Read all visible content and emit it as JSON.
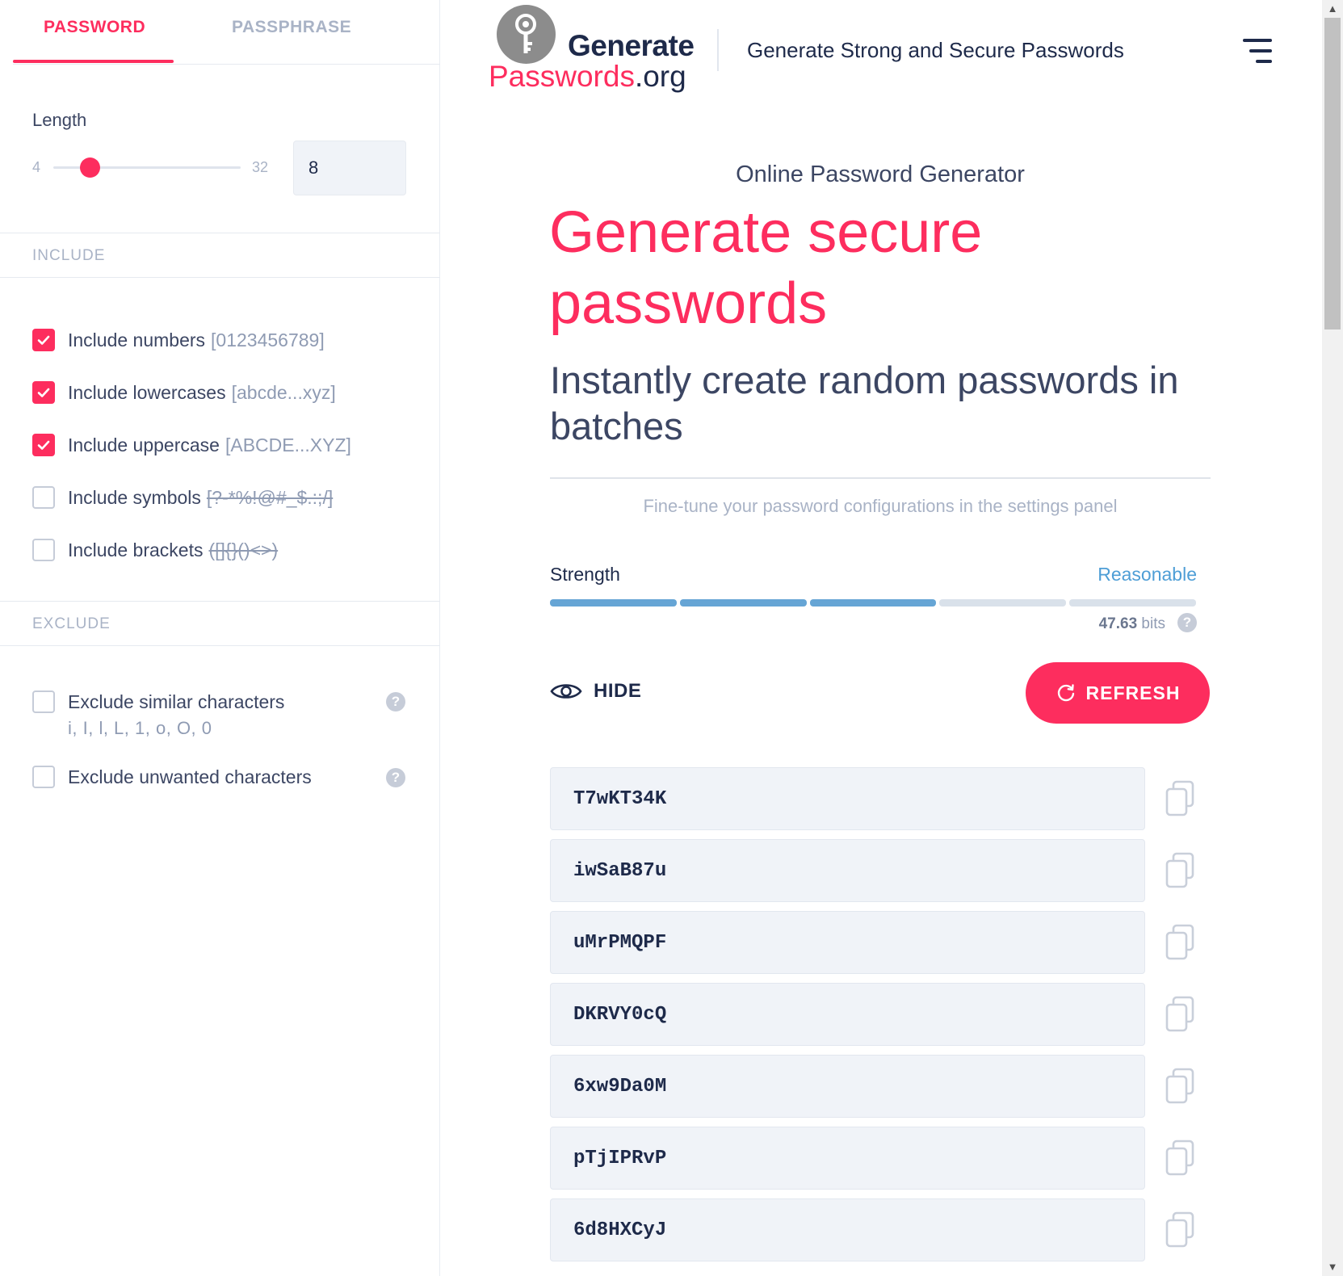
{
  "sidebar": {
    "tabs": [
      {
        "label": "PASSWORD",
        "active": true
      },
      {
        "label": "PASSPHRASE",
        "active": false
      }
    ],
    "length": {
      "label": "Length",
      "min": "4",
      "max": "32",
      "value": "8"
    },
    "include": {
      "heading": "INCLUDE",
      "options": [
        {
          "label": "Include numbers",
          "sample": "[0123456789]",
          "checked": true
        },
        {
          "label": "Include lowercases",
          "sample": "[abcde...xyz]",
          "checked": true
        },
        {
          "label": "Include uppercase",
          "sample": "[ABCDE...XYZ]",
          "checked": true
        },
        {
          "label": "Include symbols",
          "sample": "[?-*%!@#_$.:;/]",
          "checked": false
        },
        {
          "label": "Include brackets",
          "sample": "([]{}()<>)",
          "checked": false
        }
      ]
    },
    "exclude": {
      "heading": "EXCLUDE",
      "options": [
        {
          "label": "Exclude similar characters",
          "sample": "i, I, l, L, 1, o, O, 0",
          "checked": false
        },
        {
          "label": "Exclude unwanted characters",
          "checked": false
        }
      ]
    },
    "help_glyph": "?"
  },
  "header": {
    "logo_line1": "Generate",
    "logo_line2_main": "Passwords",
    "logo_line2_suffix": ".org",
    "tagline": "Generate Strong and Secure Passwords"
  },
  "main": {
    "kicker": "Online Password Generator",
    "title": "Generate secure passwords",
    "subtitle": "Instantly create random passwords in batches",
    "hint": "Fine-tune your password configurations in the settings panel",
    "strength": {
      "label": "Strength",
      "value": "Reasonable",
      "segments_total": 5,
      "segments_filled": 3,
      "bits": "47.63",
      "bits_unit": "bits"
    },
    "hide_label": "HIDE",
    "refresh_label": "REFRESH",
    "passwords": [
      "T7wKT34K",
      "iwSaB87u",
      "uMrPMQPF",
      "DKRVY0cQ",
      "6xw9Da0M",
      "pTjIPRvP",
      "6d8HXCyJ"
    ]
  },
  "colors": {
    "accent": "#fd2d5e",
    "text_dark": "#1e2a4a",
    "muted": "#a9b3c6",
    "strength": "#66a5d5"
  },
  "icons": {
    "logo": "key-icon",
    "menu": "hamburger-menu-icon",
    "hide": "eye-icon",
    "refresh": "refresh-icon",
    "copy": "copy-icon",
    "help": "help-icon",
    "checkbox": "checkmark-icon"
  }
}
